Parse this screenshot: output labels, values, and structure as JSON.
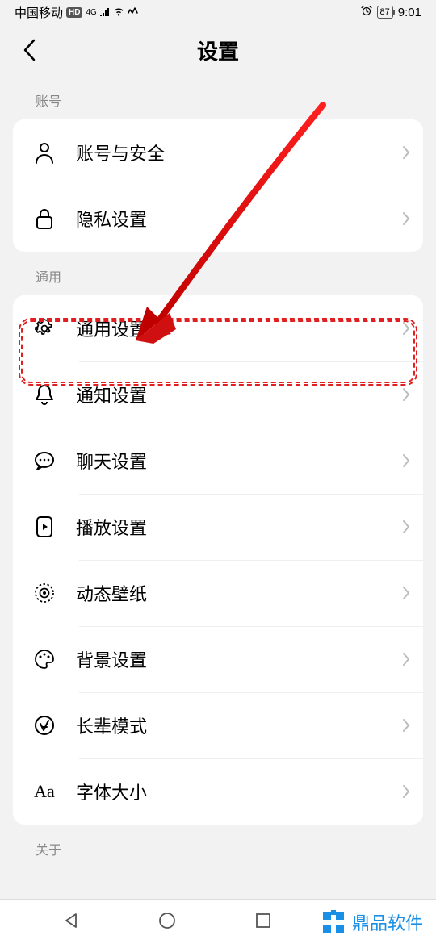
{
  "status": {
    "carrier": "中国移动",
    "hd": "HD",
    "net": "4G",
    "battery": "87",
    "time": "9:01"
  },
  "header": {
    "title": "设置"
  },
  "sections": {
    "account": {
      "label": "账号",
      "items": {
        "security": "账号与安全",
        "privacy": "隐私设置"
      }
    },
    "general": {
      "label": "通用",
      "items": {
        "general": "通用设置",
        "notification": "通知设置",
        "chat": "聊天设置",
        "playback": "播放设置",
        "wallpaper": "动态壁纸",
        "background": "背景设置",
        "elder": "长辈模式",
        "font": "字体大小"
      }
    },
    "about": {
      "label": "关于"
    }
  },
  "brand": "鼎品软件"
}
